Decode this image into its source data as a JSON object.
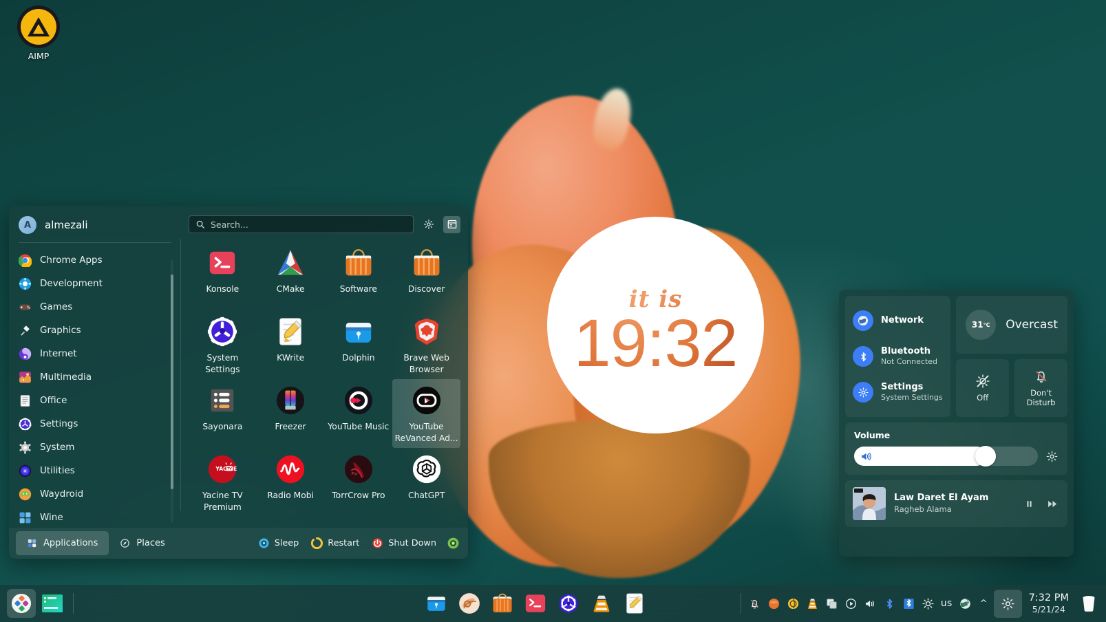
{
  "desktop": {
    "icons": [
      {
        "label": "AIMP",
        "icon": "aimp-icon"
      }
    ],
    "clock_widget": {
      "prefix": "it is",
      "time": "19:32"
    }
  },
  "launcher": {
    "user": {
      "name": "almezali",
      "initial": "A",
      "avatar": "user-avatar"
    },
    "search": {
      "placeholder": "Search...",
      "value": ""
    },
    "header_buttons": [
      {
        "name": "configure-button",
        "icon": "gear-icon"
      },
      {
        "name": "view-toggle-button",
        "icon": "panel-layout-icon"
      }
    ],
    "categories": [
      {
        "label": "Chrome Apps",
        "icon": "chrome-icon",
        "color": "#eaeaea"
      },
      {
        "label": "Development",
        "icon": "development-icon",
        "color": "#2aa3e0"
      },
      {
        "label": "Games",
        "icon": "gamepad-icon",
        "color": "#6e4a42"
      },
      {
        "label": "Graphics",
        "icon": "graphics-icon",
        "color": "#e8e8e8"
      },
      {
        "label": "Internet",
        "icon": "internet-icon",
        "color": "#6b3fd4"
      },
      {
        "label": "Multimedia",
        "icon": "multimedia-icon",
        "color": "#b5378c"
      },
      {
        "label": "Office",
        "icon": "office-icon",
        "color": "#dcdcdc"
      },
      {
        "label": "Settings",
        "icon": "settings-icon",
        "color": "#4b2fd6"
      },
      {
        "label": "System",
        "icon": "system-icon",
        "color": "#c7c7c7"
      },
      {
        "label": "Utilities",
        "icon": "utilities-icon",
        "color": "#3a2ee0"
      },
      {
        "label": "Waydroid",
        "icon": "waydroid-icon",
        "color": "#7cc24a"
      },
      {
        "label": "Wine",
        "icon": "wine-icon",
        "color": "#4a9fe0"
      }
    ],
    "apps": [
      {
        "label": "Konsole",
        "icon": "konsole-icon",
        "selected": false
      },
      {
        "label": "CMake",
        "icon": "cmake-icon",
        "selected": false
      },
      {
        "label": "Software",
        "icon": "software-icon",
        "selected": false
      },
      {
        "label": "Discover",
        "icon": "discover-icon",
        "selected": false
      },
      {
        "label": "System Settings",
        "icon": "system-settings-icon",
        "selected": false
      },
      {
        "label": "KWrite",
        "icon": "kwrite-icon",
        "selected": false
      },
      {
        "label": "Dolphin",
        "icon": "dolphin-icon",
        "selected": false
      },
      {
        "label": "Brave Web Browser",
        "icon": "brave-icon",
        "selected": false
      },
      {
        "label": "Sayonara",
        "icon": "sayonara-icon",
        "selected": false
      },
      {
        "label": "Freezer",
        "icon": "freezer-icon",
        "selected": false
      },
      {
        "label": "YouTube Music",
        "icon": "youtube-music-icon",
        "selected": false
      },
      {
        "label": "YouTube ReVanced Ad...",
        "icon": "youtube-revanced-icon",
        "selected": true
      },
      {
        "label": "Yacine TV Premium",
        "icon": "yacine-tv-icon",
        "selected": false
      },
      {
        "label": "Radio Mobi",
        "icon": "radio-mobi-icon",
        "selected": false
      },
      {
        "label": "TorrCrow Pro",
        "icon": "torrcrow-icon",
        "selected": false
      },
      {
        "label": "ChatGPT",
        "icon": "chatgpt-icon",
        "selected": false
      }
    ],
    "footer": {
      "tabs": [
        {
          "label": "Applications",
          "icon": "applications-icon",
          "active": true
        },
        {
          "label": "Places",
          "icon": "places-icon",
          "active": false
        }
      ],
      "power": [
        {
          "label": "Sleep",
          "icon": "sleep-icon",
          "color": "#3bb3e8"
        },
        {
          "label": "Restart",
          "icon": "restart-icon",
          "color": "#f2c53d"
        },
        {
          "label": "Shut Down",
          "icon": "shutdown-icon",
          "color": "#e0453a"
        }
      ],
      "leave_button": {
        "icon": "leave-icon",
        "color": "#7cc24a"
      }
    }
  },
  "tray_popup": {
    "toggles": [
      {
        "title": "Network",
        "subtitle": "",
        "icon": "network-icon"
      },
      {
        "title": "Bluetooth",
        "subtitle": "Not Connected",
        "icon": "bluetooth-icon"
      },
      {
        "title": "Settings",
        "subtitle": "System Settings",
        "icon": "gear-icon"
      }
    ],
    "weather": {
      "temperature": "31",
      "unit": "°C",
      "condition": "Overcast",
      "icon": "cloud-icon"
    },
    "mini_tiles": [
      {
        "label": "Off",
        "icon": "night-color-off-icon"
      },
      {
        "label": "Don't\nDisturb",
        "icon": "do-not-disturb-icon"
      }
    ],
    "volume": {
      "label": "Volume",
      "value": 72,
      "icon": "speaker-icon",
      "settings_icon": "gear-icon"
    },
    "media": {
      "title": "Law Daret El Ayam",
      "artist": "Ragheb Alama",
      "album_art": "album-art",
      "buttons": [
        {
          "name": "pause-button",
          "icon": "pause-icon"
        },
        {
          "name": "next-button",
          "icon": "next-track-icon"
        }
      ]
    }
  },
  "taskbar": {
    "kickoff": {
      "icon": "plasma-kickoff-icon"
    },
    "tasks": [
      {
        "name": "task-terminal",
        "icon": "terminal-window-icon"
      }
    ],
    "launchers": [
      {
        "name": "launcher-dolphin",
        "icon": "dolphin-icon"
      },
      {
        "name": "launcher-browser",
        "icon": "browser-icon"
      },
      {
        "name": "launcher-discover",
        "icon": "discover-icon"
      },
      {
        "name": "launcher-konsole",
        "icon": "konsole-icon"
      },
      {
        "name": "launcher-system-settings",
        "icon": "system-settings-icon"
      },
      {
        "name": "launcher-vlc",
        "icon": "vlc-icon"
      },
      {
        "name": "launcher-kwrite",
        "icon": "kwrite-icon"
      }
    ],
    "tray_icons": [
      {
        "name": "tray-notifications",
        "icon": "notifications-icon"
      },
      {
        "name": "tray-updates",
        "icon": "package-update-icon"
      },
      {
        "name": "tray-spectacle",
        "icon": "spectacle-icon"
      },
      {
        "name": "tray-vlc",
        "icon": "vlc-icon"
      },
      {
        "name": "tray-clipboard",
        "icon": "clipboard-icon"
      },
      {
        "name": "tray-media-player",
        "icon": "media-play-icon"
      },
      {
        "name": "tray-volume",
        "icon": "speaker-icon"
      },
      {
        "name": "tray-bluetooth",
        "icon": "bluetooth-icon"
      },
      {
        "name": "tray-bluetooth-alt",
        "icon": "bluetooth-device-icon"
      },
      {
        "name": "tray-brightness",
        "icon": "brightness-icon"
      }
    ],
    "keyboard_layout": "us",
    "network_icon": "globe-icon",
    "expand_icon": "chevron-up-icon",
    "settings_icon": "gear-icon",
    "clock": {
      "time": "7:32 PM",
      "date": "5/21/24"
    },
    "trash": {
      "icon": "trash-icon"
    }
  }
}
